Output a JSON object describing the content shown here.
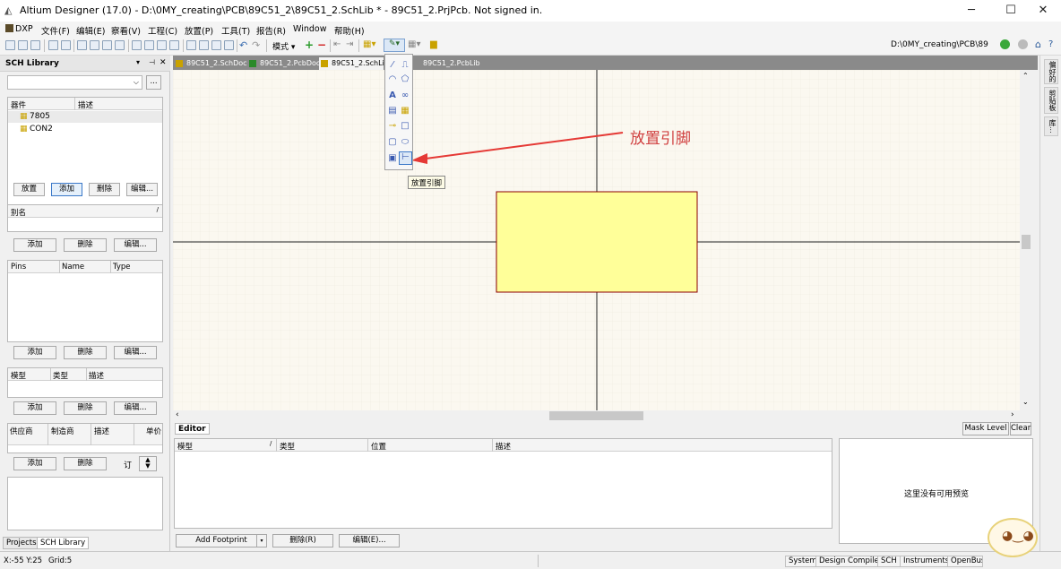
{
  "window": {
    "title": "Altium Designer (17.0) - D:\\0MY_creating\\PCB\\89C51_2\\89C51_2.SchLib * - 89C51_2.PrjPcb. Not signed in."
  },
  "menu": [
    {
      "label": "DXP"
    },
    {
      "label": "文件(F)"
    },
    {
      "label": "编辑(E)"
    },
    {
      "label": "察看(V)"
    },
    {
      "label": "工程(C)"
    },
    {
      "label": "放置(P)"
    },
    {
      "label": "工具(T)"
    },
    {
      "label": "报告(R)"
    },
    {
      "label": "Window"
    },
    {
      "label": "帮助(H)"
    }
  ],
  "toolbar": {
    "mode_label": "模式 ▾",
    "path": "D:\\0MY_creating\\PCB\\89"
  },
  "left_panel": {
    "title": "SCH Library",
    "search_value": "",
    "components_header": {
      "c1": "器件",
      "c2": "描述"
    },
    "components": [
      {
        "name": "7805"
      },
      {
        "name": "CON2"
      }
    ],
    "comp_buttons": {
      "place": "放置",
      "add": "添加",
      "delete": "删除",
      "edit": "编辑..."
    },
    "alias_header": "别名",
    "alias_buttons": {
      "add": "添加",
      "delete": "删除",
      "edit": "编辑..."
    },
    "pins_header": {
      "c1": "Pins",
      "c2": "Name",
      "c3": "Type"
    },
    "pin_buttons": {
      "add": "添加",
      "delete": "删除",
      "edit": "编辑..."
    },
    "model_header": {
      "c1": "模型",
      "c2": "类型",
      "c3": "描述"
    },
    "model_buttons": {
      "add": "添加",
      "delete": "删除",
      "edit": "编辑..."
    },
    "supplier_header": {
      "c1": "供应商",
      "c2": "制造商",
      "c3": "描述",
      "c4": "单价"
    },
    "supplier_buttons": {
      "add": "添加",
      "delete": "删除",
      "order": "订"
    },
    "bottom_tabs": {
      "projects": "Projects",
      "sch_library": "SCH Library"
    }
  },
  "doc_tabs": [
    {
      "label": "89C51_2.SchDoc"
    },
    {
      "label": "89C51_2.PcbDoc"
    },
    {
      "label": "89C51_2.SchLib"
    },
    {
      "label": "89C51_2.PcbLib"
    }
  ],
  "annotation": {
    "text": "放置引脚",
    "color": "#e53935"
  },
  "tooltip": {
    "text": "放置引脚"
  },
  "right_tabs": [
    {
      "label": "偏好的"
    },
    {
      "label": "剪贴板"
    },
    {
      "label": "库..."
    }
  ],
  "editor": {
    "tab": "Editor",
    "mask_level": "Mask Level",
    "clear": "Clear",
    "columns": {
      "c1": "模型",
      "c2": "类型",
      "c3": "位置",
      "c4": "描述"
    },
    "preview_text": "这里没有可用预览",
    "buttons": {
      "add_footprint": "Add Footprint",
      "delete": "删除(R)",
      "edit": "编辑(E)..."
    }
  },
  "status": {
    "coords": "X:-55 Y:25",
    "grid": "Grid:5",
    "buttons": [
      {
        "label": "System"
      },
      {
        "label": "Design Compiler"
      },
      {
        "label": "SCH"
      },
      {
        "label": "Instruments"
      },
      {
        "label": "OpenBus调"
      }
    ]
  },
  "colors": {
    "component_fill": "#ffff99",
    "component_stroke": "#8b0000",
    "canvas_bg": "#fbf8f0",
    "axis": "#222222"
  }
}
